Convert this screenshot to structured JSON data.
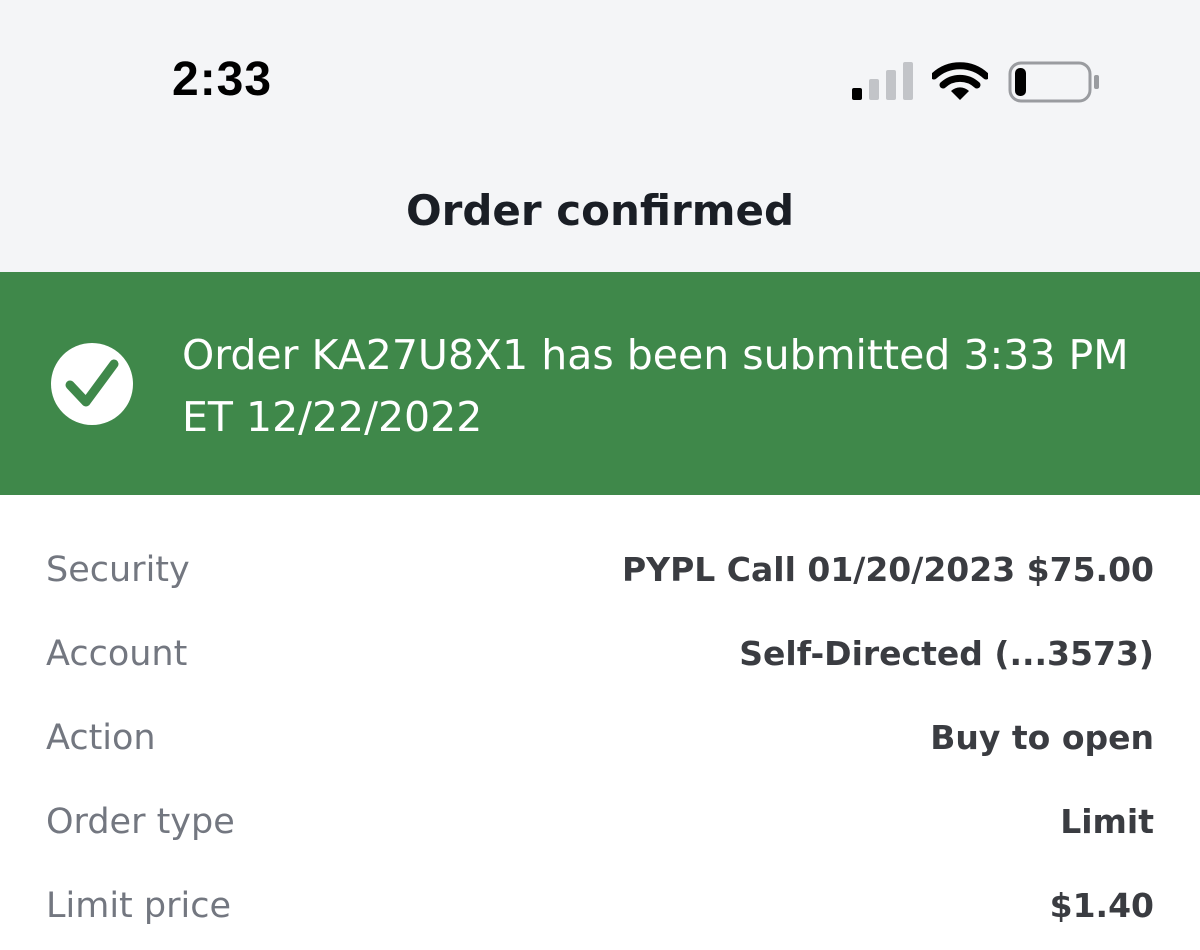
{
  "status_bar": {
    "time": "2:33",
    "signal_icon": "cellular-signal-icon",
    "wifi_icon": "wifi-icon",
    "battery_icon": "battery-low-icon",
    "battery_level": 0.15
  },
  "nav": {
    "title": "Order confirmed"
  },
  "banner": {
    "icon": "checkmark-circle-icon",
    "message": "Order KA27U8X1 has been submitted 3:33 PM ET 12/22/2022",
    "color": "#3f884a"
  },
  "details": [
    {
      "label": "Security",
      "value": "PYPL Call 01/20/2023 $75.00"
    },
    {
      "label": "Account",
      "value": "Self-Directed (...3573)"
    },
    {
      "label": "Action",
      "value": "Buy to open"
    },
    {
      "label": "Order type",
      "value": "Limit"
    },
    {
      "label": "Limit price",
      "value": "$1.40"
    }
  ]
}
